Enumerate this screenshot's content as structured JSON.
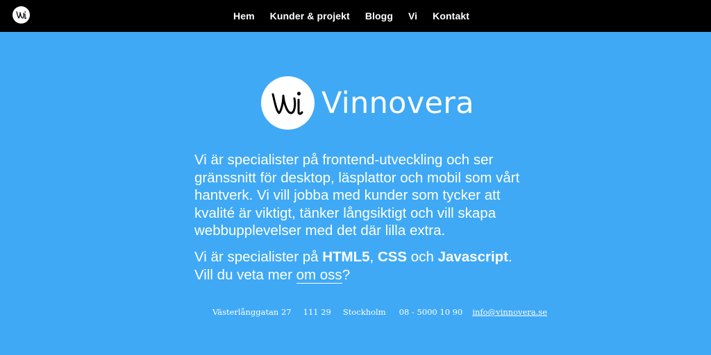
{
  "header": {
    "logo_icon": "vinnovera-vi-logo-icon",
    "nav": [
      {
        "label": "Hem"
      },
      {
        "label": "Kunder & projekt"
      },
      {
        "label": "Blogg"
      },
      {
        "label": "Vi"
      },
      {
        "label": "Kontakt"
      }
    ]
  },
  "hero": {
    "logo_icon": "vinnovera-vi-logo-icon",
    "brand_name": "Vinnovera"
  },
  "intro": {
    "paragraph1": "Vi är specialister på frontend-utveckling och ser gränssnitt för desktop, läsplattor och mobil som vårt hantverk. Vi vill jobba med kunder som tycker att kvalité är viktigt, tänker långsiktigt och vill skapa webbupplevelser med det där lilla extra.",
    "p2_part1": "Vi är specialister på ",
    "p2_html5": "HTML5",
    "p2_comma": ", ",
    "p2_css": "CSS",
    "p2_och": " och ",
    "p2_js": "Javascript",
    "p2_dot": ".",
    "p2_part2": "Vill du veta mer ",
    "p2_link": "om oss",
    "p2_q": "?"
  },
  "footer": {
    "street": "Västerlånggatan 27",
    "zip": "111 29",
    "city": "Stockholm",
    "phone": "08 - 5000 10 90",
    "email": "info@vinnovera.se"
  },
  "colors": {
    "background": "#3fa9f5",
    "topbar": "#000000",
    "text": "#ffffff"
  }
}
